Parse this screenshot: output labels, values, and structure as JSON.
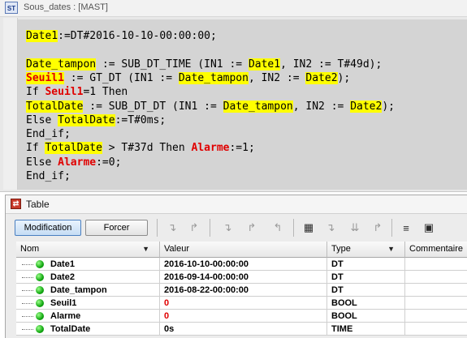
{
  "editor": {
    "window_title": "Sous_dates : [MAST]",
    "icon_label": "ST",
    "code_lines": [
      [
        {
          "t": "Date1",
          "s": "hl"
        },
        {
          "t": ":=DT#2016-10-10-00:00:00;",
          "s": ""
        }
      ],
      [],
      [
        {
          "t": "Date_tampon",
          "s": "hl"
        },
        {
          "t": " := SUB_DT_TIME (IN1 := ",
          "s": ""
        },
        {
          "t": "Date1",
          "s": "hl"
        },
        {
          "t": ", IN2 := T#49d);",
          "s": ""
        }
      ],
      [
        {
          "t": "Seuil1",
          "s": "redhl"
        },
        {
          "t": " := GT_DT (IN1 := ",
          "s": ""
        },
        {
          "t": "Date_tampon",
          "s": "hl"
        },
        {
          "t": ", IN2 := ",
          "s": ""
        },
        {
          "t": "Date2",
          "s": "hl"
        },
        {
          "t": ");",
          "s": ""
        }
      ],
      [
        {
          "t": "If ",
          "s": ""
        },
        {
          "t": "Seuil1",
          "s": "red"
        },
        {
          "t": "=1 Then",
          "s": ""
        }
      ],
      [
        {
          "t": "TotalDate",
          "s": "hl"
        },
        {
          "t": " := SUB_DT_DT (IN1 := ",
          "s": ""
        },
        {
          "t": "Date_tampon",
          "s": "hl"
        },
        {
          "t": ", IN2 := ",
          "s": ""
        },
        {
          "t": "Date2",
          "s": "hl"
        },
        {
          "t": ");",
          "s": ""
        }
      ],
      [
        {
          "t": "Else ",
          "s": ""
        },
        {
          "t": "TotalDate",
          "s": "hl"
        },
        {
          "t": ":=T#0ms;",
          "s": ""
        }
      ],
      [
        {
          "t": "End_if;",
          "s": ""
        }
      ],
      [
        {
          "t": "If ",
          "s": ""
        },
        {
          "t": "TotalDate",
          "s": "hl"
        },
        {
          "t": " > T#37d Then ",
          "s": ""
        },
        {
          "t": "Alarme",
          "s": "red"
        },
        {
          "t": ":=1;",
          "s": ""
        }
      ],
      [
        {
          "t": "Else ",
          "s": ""
        },
        {
          "t": "Alarme",
          "s": "red"
        },
        {
          "t": ":=0;",
          "s": ""
        }
      ],
      [
        {
          "t": "End_if;",
          "s": ""
        }
      ]
    ]
  },
  "table": {
    "window_title": "Table",
    "buttons": {
      "modification": "Modification",
      "forcer": "Forcer"
    },
    "columns": {
      "name": "Nom",
      "value": "Valeur",
      "type": "Type",
      "comment": "Commentaire"
    },
    "rows": [
      {
        "name": "Date1",
        "value": "2016-10-10-00:00:00",
        "type": "DT",
        "value_color": "#000000"
      },
      {
        "name": "Date2",
        "value": "2016-09-14-00:00:00",
        "type": "DT",
        "value_color": "#000000"
      },
      {
        "name": "Date_tampon",
        "value": "2016-08-22-00:00:00",
        "type": "DT",
        "value_color": "#000000"
      },
      {
        "name": "Seuil1",
        "value": "0",
        "type": "BOOL",
        "value_color": "#e00000"
      },
      {
        "name": "Alarme",
        "value": "0",
        "type": "BOOL",
        "value_color": "#e00000"
      },
      {
        "name": "TotalDate",
        "value": "0s",
        "type": "TIME",
        "value_color": "#000000"
      }
    ]
  },
  "colors": {
    "highlight": "#ffff00",
    "keyword_red": "#e00000",
    "status_green": "#12a812",
    "active_button": "#c5dcf4"
  }
}
